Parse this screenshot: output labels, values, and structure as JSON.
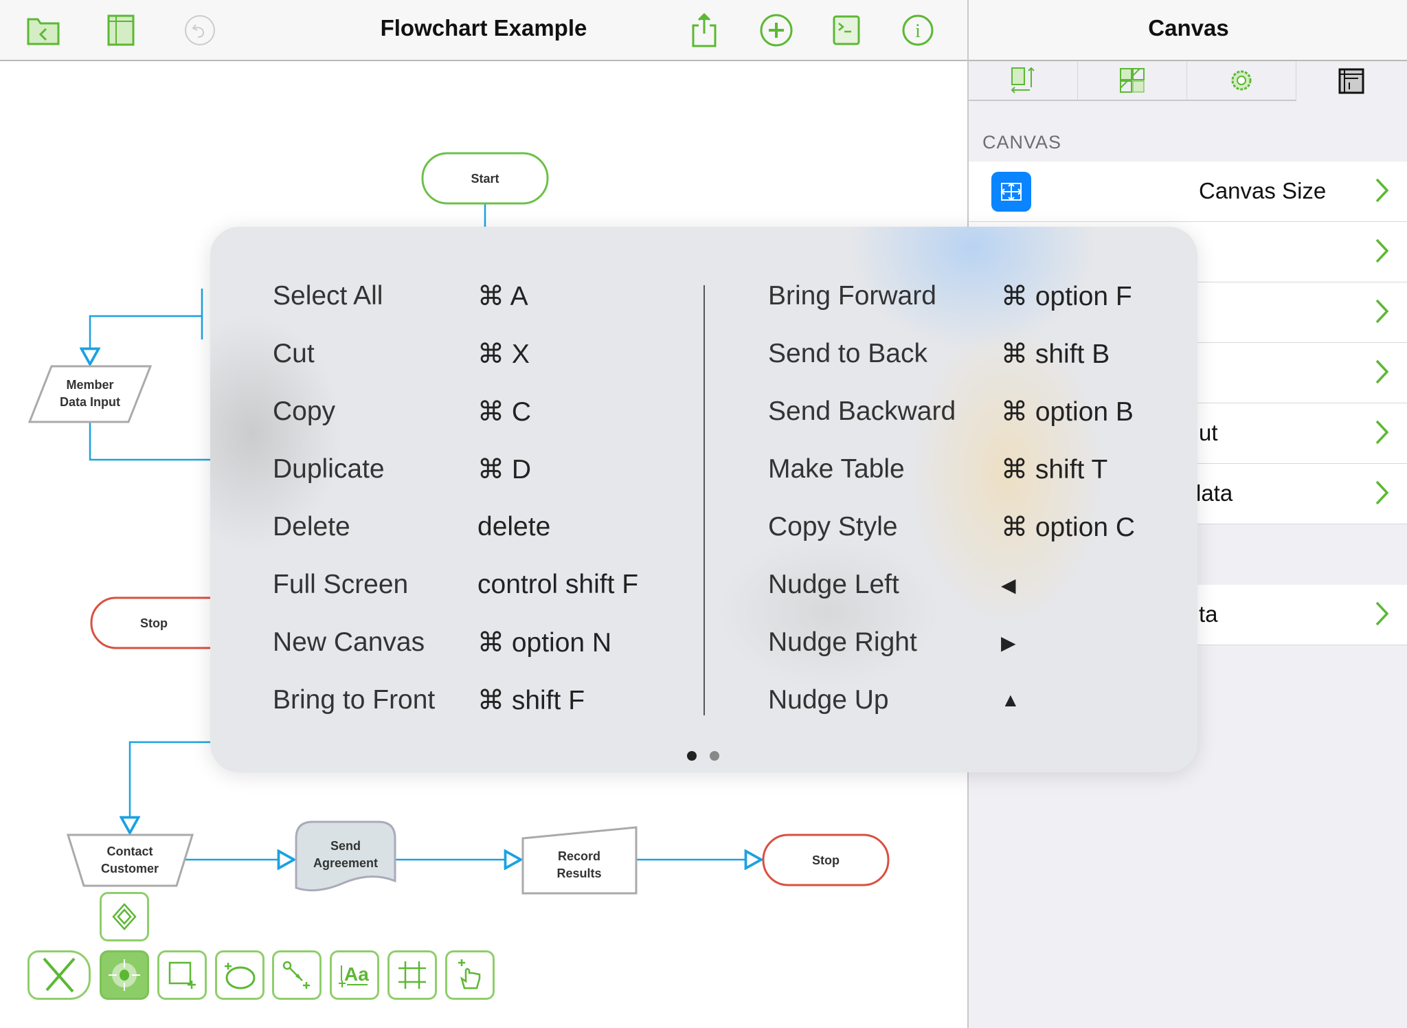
{
  "toolbar": {
    "title": "Flowchart Example",
    "left_icons": [
      "folder-back-icon",
      "sidebar-icon",
      "undo-icon"
    ],
    "right_icons": [
      "share-icon",
      "add-icon",
      "console-icon",
      "info-icon"
    ]
  },
  "inspector": {
    "title": "Canvas",
    "tabs": [
      "canvas-size-tab-icon",
      "grid-tab-icon",
      "settings-gear-icon",
      "layout-tab-icon"
    ],
    "section_label": "CANVAS",
    "rows": [
      {
        "label": "Canvas Size",
        "icon": "move-arrows-icon"
      },
      {
        "label": ""
      },
      {
        "label": ""
      },
      {
        "label": ""
      },
      {
        "label": "ut"
      },
      {
        "label": "lata"
      },
      {
        "label": "ta"
      }
    ]
  },
  "flowchart": {
    "nodes": {
      "start": "Start",
      "member": [
        "Member",
        "Data Input"
      ],
      "stop_left": "Stop",
      "contact": [
        "Contact",
        "Customer"
      ],
      "send": [
        "Send",
        "Agreement"
      ],
      "record": [
        "Record",
        "Results"
      ],
      "stop_right": "Stop"
    }
  },
  "shortcuts": {
    "left": [
      {
        "label": "Select All",
        "keys": "⌘ A"
      },
      {
        "label": "Cut",
        "keys": "⌘ X"
      },
      {
        "label": "Copy",
        "keys": "⌘ C"
      },
      {
        "label": "Duplicate",
        "keys": "⌘ D"
      },
      {
        "label": "Delete",
        "keys": "delete"
      },
      {
        "label": "Full Screen",
        "keys": "control shift F"
      },
      {
        "label": "New Canvas",
        "keys": "⌘ option N"
      },
      {
        "label": "Bring to Front",
        "keys": "⌘ shift F"
      }
    ],
    "right": [
      {
        "label": "Bring Forward",
        "keys": "⌘ option F"
      },
      {
        "label": "Send to Back",
        "keys": "⌘ shift B"
      },
      {
        "label": "Send Backward",
        "keys": "⌘ option B"
      },
      {
        "label": "Make Table",
        "keys": "⌘ shift T"
      },
      {
        "label": "Copy Style",
        "keys": "⌘ option C"
      },
      {
        "label": "Nudge Left",
        "keys": "◀"
      },
      {
        "label": "Nudge Right",
        "keys": "▶"
      },
      {
        "label": "Nudge Up",
        "keys": "▲"
      }
    ],
    "page": 1,
    "pages": 2
  },
  "tools": [
    "stencil-pencil-icon",
    "selection-tool-icon",
    "shape-tool-icon",
    "freehand-tool-icon",
    "line-tool-icon",
    "text-tool-icon",
    "diagram-grid-icon",
    "hand-tool-icon",
    "diamond-shape-icon"
  ],
  "colors": {
    "accent": "#5cb833",
    "connector": "#1ba1e2",
    "stop": "#d9503f",
    "start": "#6cc04a",
    "blue_button": "#0a84ff"
  }
}
